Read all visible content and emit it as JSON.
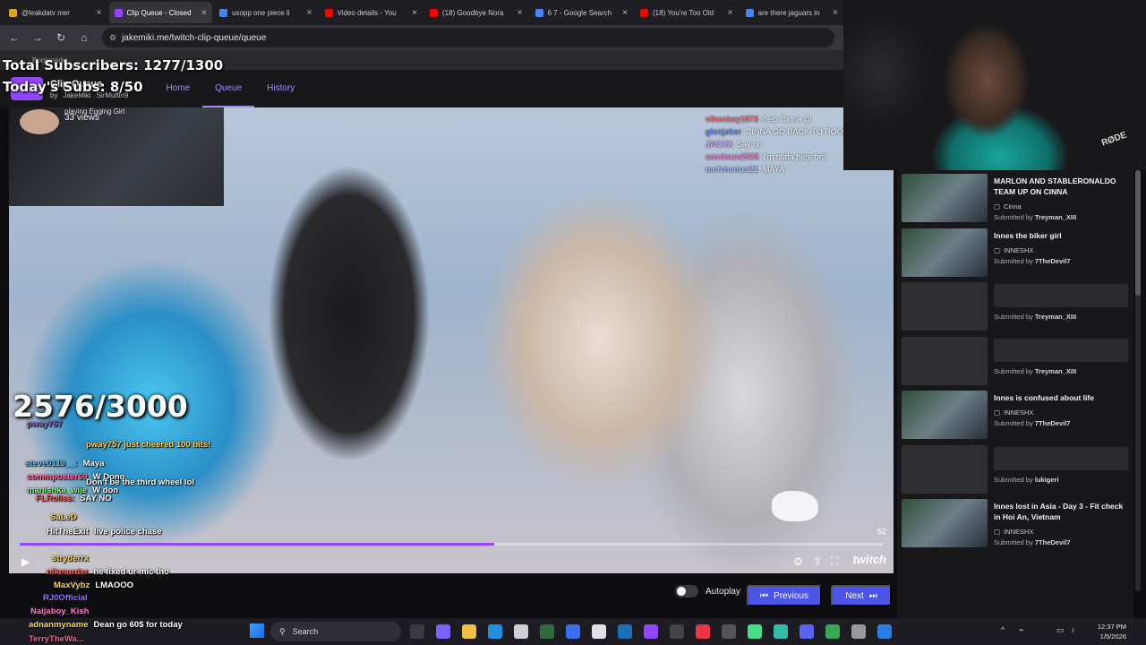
{
  "browser": {
    "tabs": [
      {
        "label": "@leakdatv mer",
        "color": "#e0a31b"
      },
      {
        "label": "Clip Queue - Closed",
        "color": "#9146ff",
        "active": true
      },
      {
        "label": "usopp one piece li",
        "color": "#4285f4"
      },
      {
        "label": "Video details - You",
        "color": "#ff0000"
      },
      {
        "label": "(18) Goodbye Nora",
        "color": "#ff0000"
      },
      {
        "label": "6 7 - Google Search",
        "color": "#4285f4"
      },
      {
        "label": "(18) You're Too Old",
        "color": "#ff0000"
      },
      {
        "label": "are there jaguars in",
        "color": "#4285f4"
      }
    ],
    "url": "jakemiki.me/twitch-clip-queue/queue",
    "bookmarks_label": "Bookmarks"
  },
  "overlay": {
    "total_subs": "Total Subscribers: 1277/1300",
    "today_subs": "Today's Subs: 8/50",
    "counter": "2576/3000"
  },
  "app": {
    "title": "Clip Queue",
    "by_label": "by",
    "author1": "JakeMiki",
    "author2": "SirMuffin9",
    "nav": {
      "home": "Home",
      "queue": "Queue",
      "history": "History"
    }
  },
  "player": {
    "clip_meta": "playing Egging Girl",
    "views": "33 views",
    "time_right": "52",
    "progress": 0.55,
    "twitch_label": "twitch",
    "autoplay_label": "Autoplay",
    "prev_label": "Previous",
    "next_label": "Next"
  },
  "stream_chat": [
    {
      "user": "vthockey1973",
      "msg": ": help Cinna @",
      "color": "#ff6b6b"
    },
    {
      "user": "glenjoker",
      "msg": ": CINNA GO BACK TO ROOM",
      "color": "#6b8cff"
    },
    {
      "user": "JACXX",
      "msg": ": Say no",
      "color": "#d0a0ff"
    },
    {
      "user": "sandman2538",
      "msg": ": I'm outta here bro",
      "color": "#ff7bd0"
    },
    {
      "user": "mcfchamza21",
      "msg": ": MAYA",
      "color": "#9fb7ff"
    }
  ],
  "chat_overlay": [
    {
      "user": "pway757",
      "msg": "",
      "color": "#8a6bbf"
    },
    {
      "user": "",
      "msg": "pway757 just cheered 100 bits!",
      "color": "#ffd060"
    },
    {
      "user": "steve0119__:",
      "msg": "Maya",
      "color": "#4fc3ff"
    },
    {
      "user": "commposter69",
      "msg": "W Dono",
      "color": "#ff6b9e"
    },
    {
      "user": "",
      "msg": "Don't be the third wheel lol",
      "color": "#ffffff"
    },
    {
      "user": "manishka_wije",
      "msg": "W don",
      "color": "#7dff7d"
    },
    {
      "user": "FLRoliss:",
      "msg": "SAY NO",
      "color": "#ff5b5b"
    },
    {
      "user": "SaLeD",
      "msg": "",
      "color": "#ffd84a"
    },
    {
      "user": "HitTheExit",
      "msg": "live police chase",
      "color": "#ffffff"
    },
    {
      "user": "stryderrx",
      "msg": "",
      "color": "#ffd84a"
    },
    {
      "user": "nikmurder",
      "msg": "he fixed ur mic tho",
      "color": "#ff5b5b"
    },
    {
      "user": "MaxVybz",
      "msg": "LMAOOO",
      "color": "#ffd84a"
    },
    {
      "user": "RJ0Official",
      "msg": "",
      "color": "#9a6bff"
    },
    {
      "user": "Naijaboy_Kish",
      "msg": "",
      "color": "#ff7bd0"
    },
    {
      "user": "adnanmyname",
      "msg": "Dean go 60$ for today",
      "color": "#ffd84a"
    },
    {
      "user": "TerryTheWa...",
      "msg": "",
      "color": "#ff5b8a"
    }
  ],
  "queue_items": [
    {
      "title": "MARLON AND STABLERONALDO TEAM UP ON CINNA",
      "channel": "Cinna",
      "submitted_by": "Treyman_XIII",
      "thumb": true
    },
    {
      "title": "Innes the biker girl",
      "channel": "INNESHX",
      "submitted_by": "7TheDevil7",
      "thumb": true
    },
    {
      "title": "",
      "channel": "",
      "submitted_by": "Treyman_XIII",
      "thumb": false
    },
    {
      "title": "",
      "channel": "",
      "submitted_by": "Treyman_XIII",
      "thumb": false
    },
    {
      "title": "Innes is confused about life",
      "channel": "INNESHX",
      "submitted_by": "7TheDevil7",
      "thumb": true
    },
    {
      "title": "",
      "channel": "",
      "submitted_by": "lukigeri",
      "thumb": false
    },
    {
      "title": "Innes lost in Asia - Day 3 - Fit check in Hoi An, Vietnam",
      "channel": "INNESHX",
      "submitted_by": "7TheDevil7",
      "thumb": true
    }
  ],
  "submitted_prefix": "Submitted by",
  "webcam": {
    "mic_brand": "RØDE"
  },
  "taskbar": {
    "search_label": "Search",
    "time": "12:37 PM",
    "date": "1/5/2026"
  }
}
